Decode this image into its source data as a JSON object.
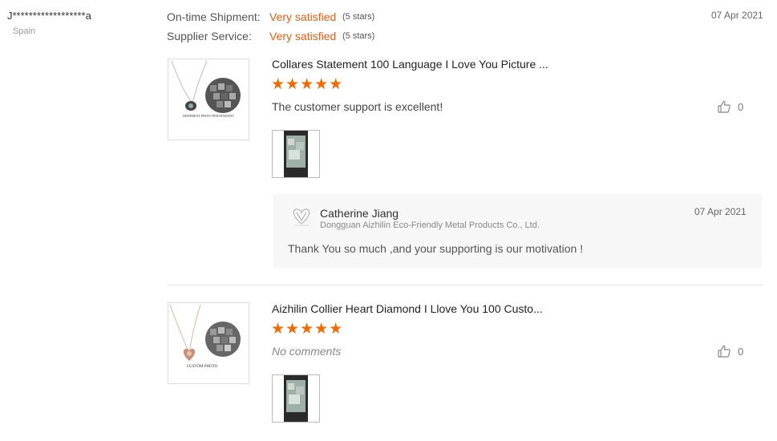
{
  "reviewer": {
    "name": "J******************a",
    "country": "Spain"
  },
  "ratings": [
    {
      "label": "On-time Shipment:",
      "value": "Very satisfied",
      "stars": "(5 stars)"
    },
    {
      "label": "Supplier Service:",
      "value": "Very satisfied",
      "stars": "(5 stars)"
    }
  ],
  "review_date": "07 Apr 2021",
  "reviews": [
    {
      "product_title": "Collares Statement 100 Language I Love You Picture ...",
      "stars": "★★★★★",
      "rating": 5,
      "text": "The customer support is excellent!",
      "likes": "0",
      "thumb_caption": "DIFFERENT PHOTO PER PENDANT"
    },
    {
      "product_title": "Aizhilin Collier Heart Diamond I Llove You 100 Custo...",
      "stars": "★★★★★",
      "rating": 5,
      "text": "No comments",
      "likes": "0",
      "thumb_caption": "CUSTOM PHOTO"
    }
  ],
  "reply": {
    "name": "Catherine Jiang",
    "company": "Dongguan Aizhilin Eco-Friendly Metal Products Co., Ltd.",
    "date": "07 Apr 2021",
    "text": "Thank You so much  ,and your supporting is our motivation !"
  },
  "colors": {
    "accent": "#f05a0e",
    "star": "#f56a00",
    "reply_bg": "#f7f7f7"
  },
  "icons": {
    "like": "thumbs-up-icon"
  }
}
